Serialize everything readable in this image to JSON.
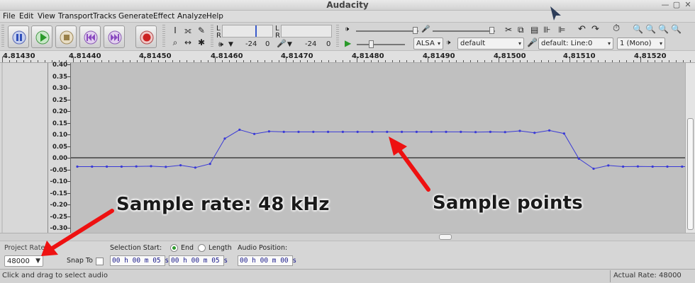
{
  "window": {
    "title": "Audacity"
  },
  "menu": [
    "File",
    "Edit",
    "View",
    "Transport",
    "Tracks",
    "Generate",
    "Effect",
    "Analyze",
    "Help"
  ],
  "meters": {
    "rec_left": "L",
    "rec_right": "R",
    "play_left": "L",
    "play_right": "R",
    "rec_level": "-24",
    "rec_zero": "0",
    "play_level": "-24",
    "play_zero": "0"
  },
  "device": {
    "host": "ALSA",
    "playback": "default",
    "recording": "default: Line:0",
    "channels": "1 (Mono)"
  },
  "ruler": {
    "labels": [
      "4.81430",
      "4.81440",
      "4.81450",
      "4.81460",
      "4.81470",
      "4.81480",
      "4.81490",
      "4.81500",
      "4.81510",
      "4.81520"
    ]
  },
  "vruler": {
    "labels": [
      "0.40",
      "0.35",
      "0.30",
      "0.25",
      "0.20",
      "0.15",
      "0.10",
      "0.05",
      "0.00",
      "-0.05",
      "-0.10",
      "-0.15",
      "-0.20",
      "-0.25",
      "-0.30"
    ]
  },
  "samples": [
    -0.038,
    -0.038,
    -0.038,
    -0.038,
    -0.037,
    -0.036,
    -0.039,
    -0.032,
    -0.042,
    -0.026,
    0.082,
    0.12,
    0.102,
    0.113,
    0.111,
    0.111,
    0.111,
    0.111,
    0.111,
    0.111,
    0.111,
    0.111,
    0.111,
    0.111,
    0.111,
    0.111,
    0.111,
    0.11,
    0.111,
    0.11,
    0.115,
    0.107,
    0.117,
    0.104,
    -0.004,
    -0.047,
    -0.033,
    -0.038,
    -0.037,
    -0.038,
    -0.038,
    -0.038,
    -0.038,
    -0.038
  ],
  "selection": {
    "project_rate_label": "Project Rate (Hz):",
    "project_rate": "48000",
    "snap_to_label": "Snap To",
    "selection_start_label": "Selection Start:",
    "end_label": "End",
    "length_label": "Length",
    "audio_position_label": "Audio Position:",
    "start_time": "00 h 00 m 05 s",
    "end_time": "00 h 00 m 05 s",
    "audio_time": "00 h 00 m 00 s"
  },
  "status": {
    "left": "Click and drag to select audio",
    "right": "Actual Rate: 48000"
  },
  "annotations": {
    "rate": "Sample rate: 48 kHz",
    "points": "Sample points"
  },
  "colors": {
    "waveform": "#3a3ad6",
    "zero_line": "#000000",
    "arrow": "#ee1111",
    "record": "#cc2222",
    "play": "#2a9a2a",
    "pause": "#3a5acc"
  }
}
